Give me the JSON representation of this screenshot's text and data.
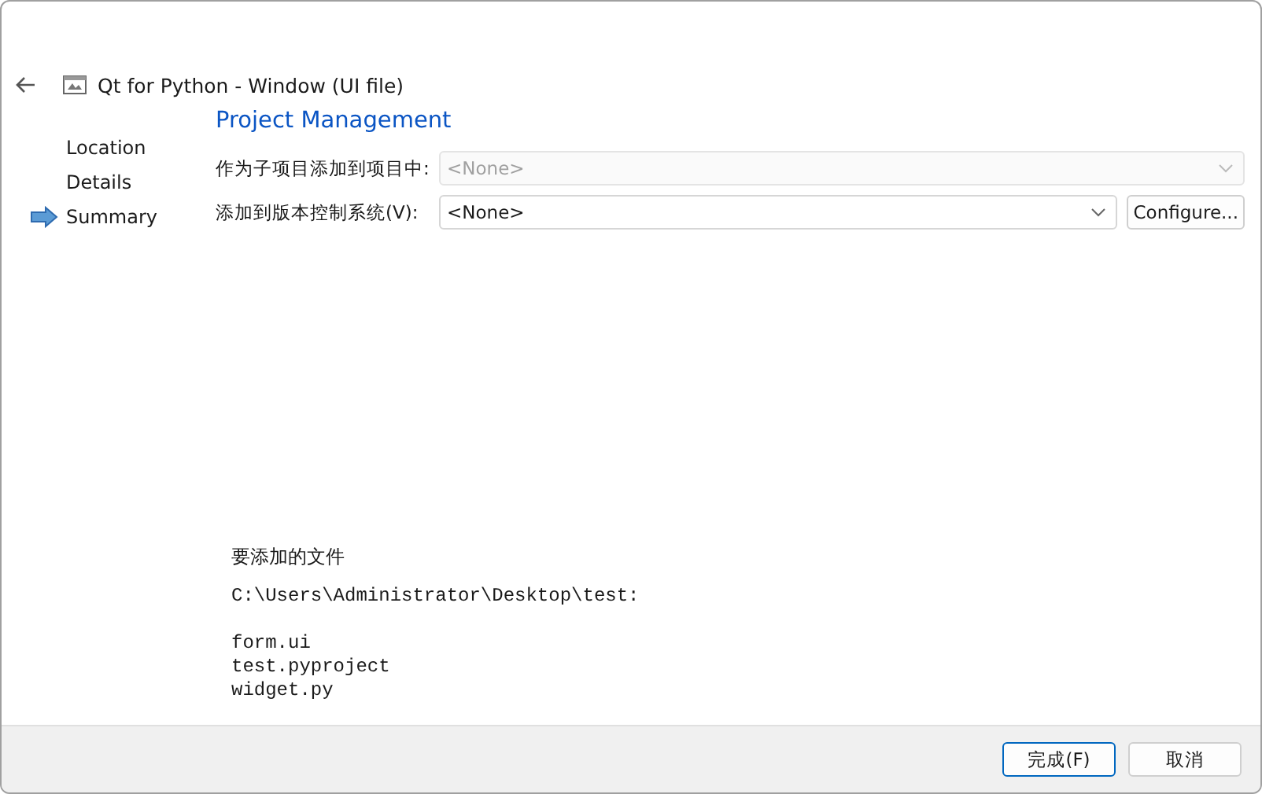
{
  "window": {
    "title": "Qt for Python - Window (UI file)"
  },
  "sidebar": {
    "items": [
      {
        "label": "Location",
        "selected": false
      },
      {
        "label": "Details",
        "selected": false
      },
      {
        "label": "Summary",
        "selected": true
      }
    ]
  },
  "page": {
    "heading": "Project Management",
    "fields": [
      {
        "label": "作为子项目添加到项目中:",
        "value": "<None>",
        "disabled": true
      },
      {
        "label": "添加到版本控制系统(V):",
        "value": "<None>",
        "disabled": false,
        "button": "Configure..."
      }
    ],
    "files_heading": "要添加的文件",
    "files_path": "C:\\Users\\Administrator\\Desktop\\test:",
    "file_names": [
      "form.ui",
      "test.pyproject",
      "widget.py"
    ]
  },
  "buttons": [
    {
      "label": "完成(F)",
      "default": true
    },
    {
      "label": "取消",
      "default": false
    }
  ]
}
